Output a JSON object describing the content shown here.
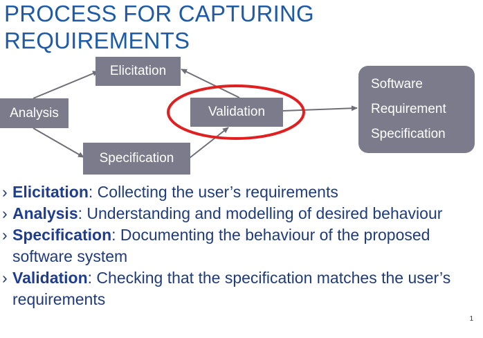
{
  "title": {
    "line1": "PROCESS FOR CAPTURING",
    "line2": "REQUIREMENTS"
  },
  "diagram": {
    "elicitation": "Elicitation",
    "analysis": "Analysis",
    "validation": "Validation",
    "specification": "Specification",
    "srs_lines": [
      "Software",
      "Requirement",
      "Specification"
    ]
  },
  "bullets": [
    {
      "term": "Elicitation",
      "desc": ": Collecting the user’s requirements"
    },
    {
      "term": "Analysis",
      "desc": ": Understanding and modelling of desired behaviour"
    },
    {
      "term": "Specification",
      "desc": ": Documenting the behaviour of the proposed software system"
    },
    {
      "term": "Validation",
      "desc": ": Checking that the specification matches the user’s requirements"
    }
  ],
  "bullet_marker": "›",
  "page_number": "1",
  "colors": {
    "title": "#1f5aa6",
    "box": "#7b7b8c",
    "highlight": "#e02020",
    "arrow": "#6e6e78"
  }
}
